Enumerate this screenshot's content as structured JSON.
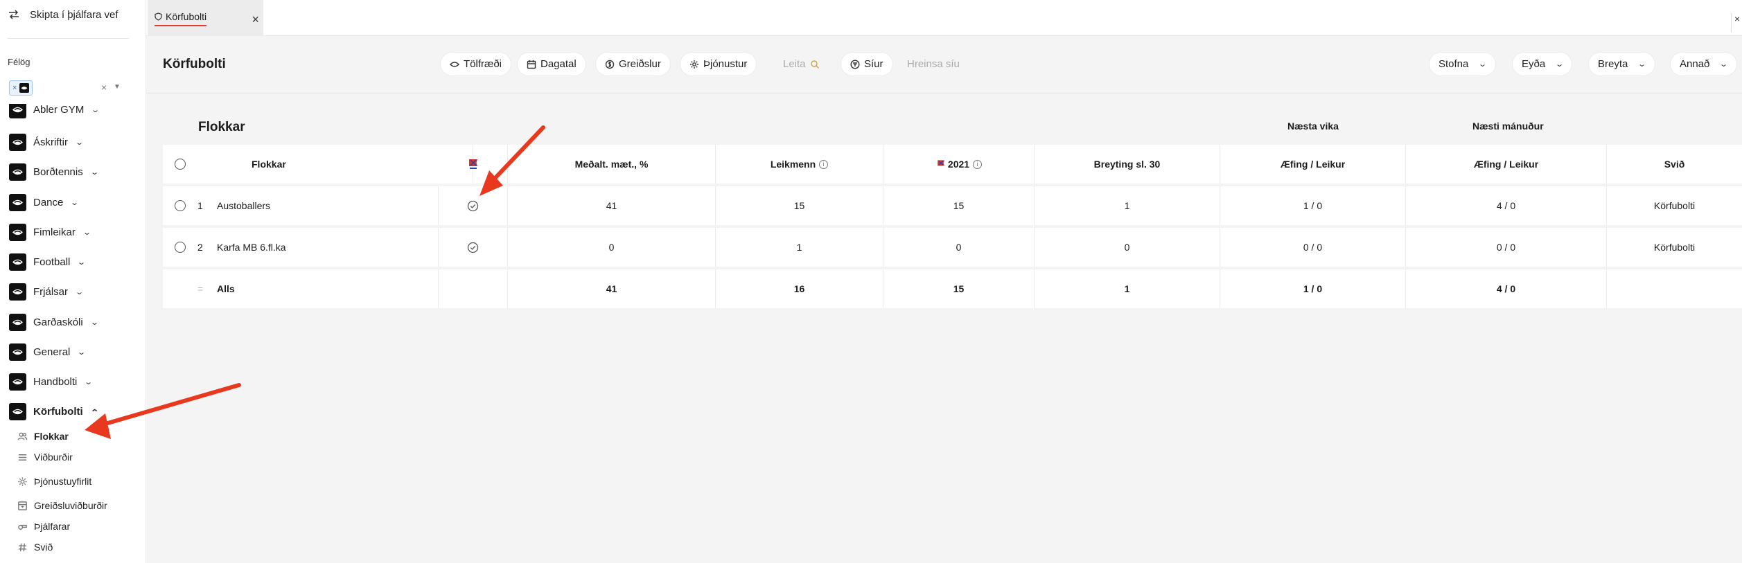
{
  "sidebar": {
    "switch_label": "Skipta í þjálfara vef",
    "felog_label": "Félög",
    "chip_x": "×",
    "clear": "×",
    "clubs": [
      {
        "name": "Abler GYM",
        "chev": "⌄"
      },
      {
        "name": "Áskriftir",
        "chev": "⌄"
      },
      {
        "name": "Borðtennis",
        "chev": "⌄"
      },
      {
        "name": "Dance",
        "chev": "⌄"
      },
      {
        "name": "Fimleikar",
        "chev": "⌄"
      },
      {
        "name": "Football",
        "chev": "⌄"
      },
      {
        "name": "Frjálsar",
        "chev": "⌄"
      },
      {
        "name": "Garðaskóli",
        "chev": "⌄"
      },
      {
        "name": "General",
        "chev": "⌄"
      },
      {
        "name": "Handbolti",
        "chev": "⌄"
      },
      {
        "name": "Körfubolti",
        "chev": "⌃"
      }
    ],
    "subitems": [
      {
        "label": "Flokkar",
        "icon": "users-icon"
      },
      {
        "label": "Viðburðir",
        "icon": "list-icon"
      },
      {
        "label": "Þjónustuyfirlit",
        "icon": "gear-icon"
      },
      {
        "label": "Greiðsluviðburðir",
        "icon": "payment-icon"
      },
      {
        "label": "Þjálfarar",
        "icon": "whistle-icon"
      },
      {
        "label": "Svið",
        "icon": "hash-icon"
      }
    ]
  },
  "tab": {
    "label": "Körfubolti",
    "close": "×"
  },
  "toolbar": {
    "title": "Körfubolti",
    "tolfraedi": "Tölfræði",
    "dagatal": "Dagatal",
    "greidslur": "Greiðslur",
    "thjonustur": "Þjónustur",
    "leita": "Leita",
    "siur": "Síur",
    "hreinsa": "Hreinsa síu",
    "stofna": "Stofna",
    "eyda": "Eyða",
    "breyta": "Breyta",
    "annad": "Annað"
  },
  "table": {
    "title": "Flokkar",
    "group_next_week": "Næsta vika",
    "group_next_month": "Næsti mánuður",
    "headers": {
      "flokkar": "Flokkar",
      "medalt": "Meðalt. mæt., %",
      "leikmenn": "Leikmenn",
      "year": "2021",
      "breyting": "Breyting sl. 30",
      "aefing_week": "Æfing / Leikur",
      "aefing_month": "Æfing / Leikur",
      "svid": "Svið"
    },
    "rows": [
      {
        "num": "1",
        "name": "Austoballers",
        "medalt": "41",
        "leikmenn": "15",
        "year": "15",
        "breyting": "1",
        "week": "1 / 0",
        "month": "4 / 0",
        "svid": "Körfubolti"
      },
      {
        "num": "2",
        "name": "Karfa MB 6.fl.ka",
        "medalt": "0",
        "leikmenn": "1",
        "year": "0",
        "breyting": "0",
        "week": "0 / 0",
        "month": "0 / 0",
        "svid": "Körfubolti"
      }
    ],
    "total": {
      "label": "Alls",
      "medalt": "41",
      "leikmenn": "16",
      "year": "15",
      "breyting": "1",
      "week": "1 / 0",
      "month": "4 / 0"
    }
  },
  "colors": {
    "accent_red": "#e8391f",
    "tab_underline": "#e53935"
  }
}
